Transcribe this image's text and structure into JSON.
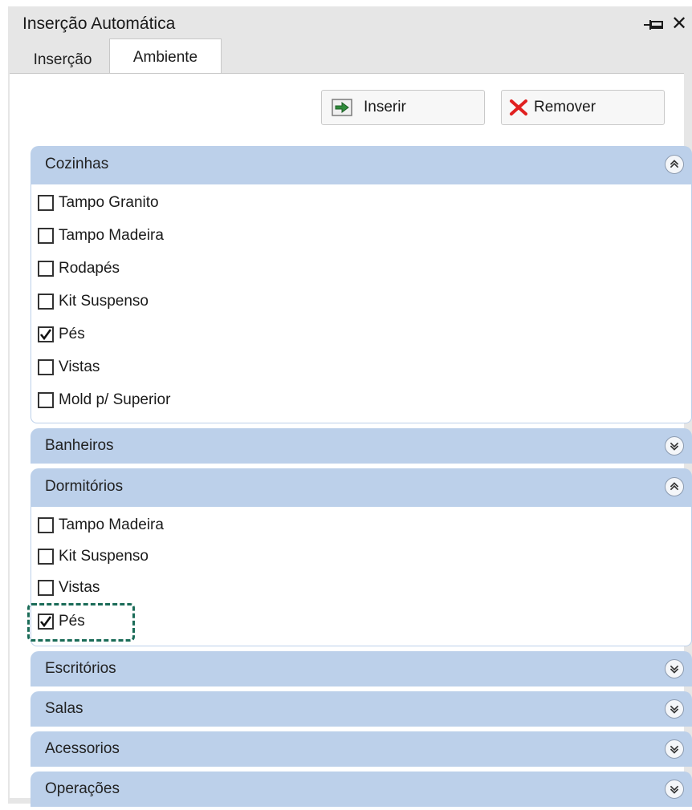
{
  "window": {
    "title": "Inserção Automática"
  },
  "tabs": [
    {
      "label": "Inserção",
      "active": false
    },
    {
      "label": "Ambiente",
      "active": true
    }
  ],
  "toolbar": {
    "insert_label": "Inserir",
    "remove_label": "Remover"
  },
  "colors": {
    "group_header": "#bcd0ea",
    "highlight": "#1a6b57",
    "insert_icon": "#2e8b3a",
    "remove_icon": "#e02020"
  },
  "groups": {
    "cozinhas": {
      "label": "Cozinhas",
      "expanded": true,
      "items": [
        {
          "label": "Tampo Granito",
          "checked": false
        },
        {
          "label": "Tampo Madeira",
          "checked": false
        },
        {
          "label": "Rodapés",
          "checked": false
        },
        {
          "label": "Kit Suspenso",
          "checked": false
        },
        {
          "label": "Pés",
          "checked": true
        },
        {
          "label": "Vistas",
          "checked": false
        },
        {
          "label": "Mold p/ Superior",
          "checked": false
        }
      ]
    },
    "banheiros": {
      "label": "Banheiros",
      "expanded": false
    },
    "dormitorios": {
      "label": "Dormitórios",
      "expanded": true,
      "items": [
        {
          "label": "Tampo Madeira",
          "checked": false
        },
        {
          "label": "Kit Suspenso",
          "checked": false
        },
        {
          "label": "Vistas",
          "checked": false
        },
        {
          "label": "Pés",
          "checked": true
        }
      ]
    },
    "escritorios": {
      "label": "Escritórios",
      "expanded": false
    },
    "salas": {
      "label": "Salas",
      "expanded": false
    },
    "acessorios": {
      "label": "Acessorios",
      "expanded": false
    },
    "operacoes": {
      "label": "Operações",
      "expanded": false
    }
  }
}
